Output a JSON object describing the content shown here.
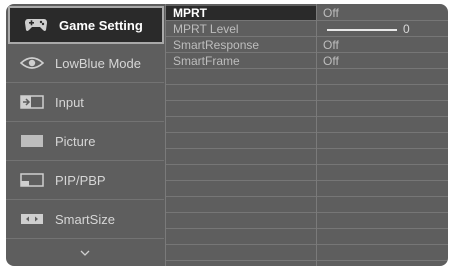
{
  "sidebar": {
    "items": [
      {
        "label": "Game Setting",
        "icon": "gamepad-icon"
      },
      {
        "label": "LowBlue Mode",
        "icon": "eye-icon"
      },
      {
        "label": "Input",
        "icon": "input-icon"
      },
      {
        "label": "Picture",
        "icon": "picture-icon"
      },
      {
        "label": "PIP/PBP",
        "icon": "pip-icon"
      },
      {
        "label": "SmartSize",
        "icon": "smartsize-icon"
      }
    ],
    "more_icon": "chevron-down-icon"
  },
  "submenu": {
    "items": [
      "MPRT",
      "MPRT Level",
      "SmartResponse",
      "SmartFrame"
    ]
  },
  "values": {
    "mprt": "Off",
    "mprt_level": "0",
    "mprt_level_fraction": 0,
    "smart_response": "Off",
    "smart_frame": "Off"
  },
  "colors": {
    "panel": "#5e5e5e",
    "selected": "#2a2a2a",
    "text": "#d6d6d6",
    "highlight_text": "#ffffff"
  }
}
